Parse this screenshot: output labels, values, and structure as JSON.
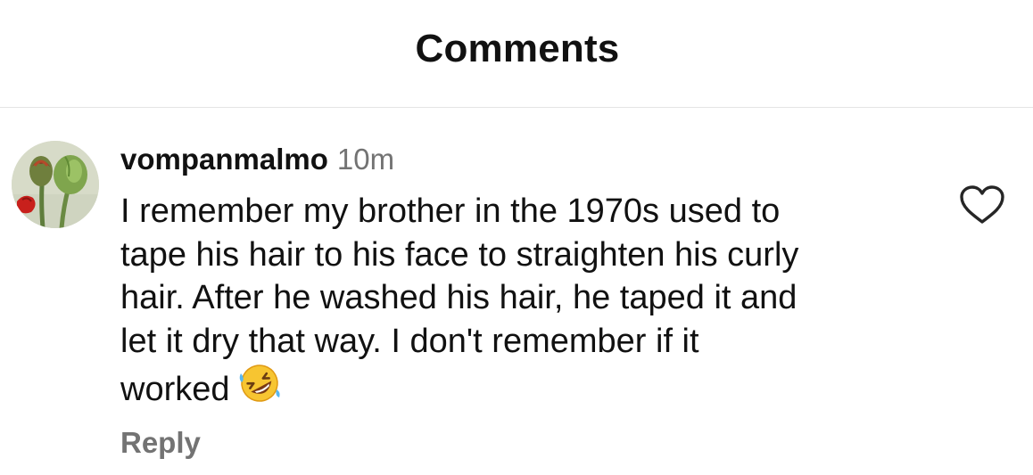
{
  "header": {
    "title": "Comments"
  },
  "comment": {
    "username": "vompanmalmo",
    "timestamp": "10m",
    "text_lines": [
      "I remember my brother in the 1970s used to",
      "tape his hair to his face to straighten his curly",
      "hair. After he washed his hair, he taped it and",
      "let it dry that way. I don't remember if it",
      "worked"
    ],
    "emoji": "rolling-on-floor-laughing",
    "reply_label": "Reply",
    "like_icon": "heart-outline-icon"
  },
  "colors": {
    "text_primary": "#111111",
    "text_secondary": "#737373",
    "divider": "#e4e4e4",
    "background": "#ffffff"
  }
}
